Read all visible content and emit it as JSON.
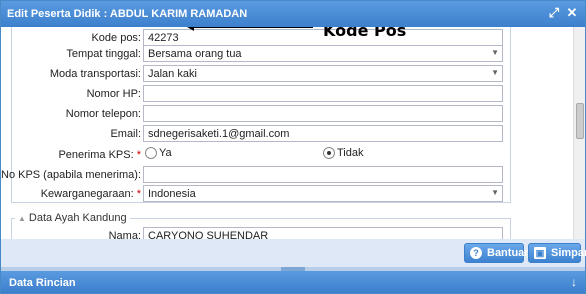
{
  "window": {
    "title": "Edit Peserta Didik : ABDUL KARIM RAMADAN"
  },
  "form": {
    "kode_pos": {
      "label": "Kode pos:",
      "value": "42273"
    },
    "tempat_tinggal": {
      "label": "Tempat tinggal:",
      "value": "Bersama orang tua"
    },
    "moda_transportasi": {
      "label": "Moda transportasi:",
      "value": "Jalan kaki"
    },
    "nomor_hp": {
      "label": "Nomor HP:",
      "value": ""
    },
    "nomor_telepon": {
      "label": "Nomor telepon:",
      "value": ""
    },
    "email": {
      "label": "Email:",
      "value": "sdnegerisaketi.1@gmail.com"
    },
    "penerima_kps": {
      "label": "Penerima KPS:",
      "required_mark": "*",
      "option_ya": "Ya",
      "option_tidak": "Tidak",
      "selected": "Tidak"
    },
    "no_kps": {
      "label": "No KPS (apabila menerima):",
      "value": ""
    },
    "kewarganegaraan": {
      "label": "Kewarganegaraan:",
      "required_mark": "*",
      "value": "Indonesia"
    }
  },
  "annotation": {
    "text": "Kode Pos"
  },
  "section_ayah": {
    "legend": "Data Ayah Kandung",
    "nama": {
      "label": "Nama:",
      "value": "CARYONO SUHENDAR"
    }
  },
  "buttons": {
    "bantuan": "Bantuan",
    "simpan": "Simpan"
  },
  "bottom_panel": {
    "title": "Data Rincian"
  }
}
